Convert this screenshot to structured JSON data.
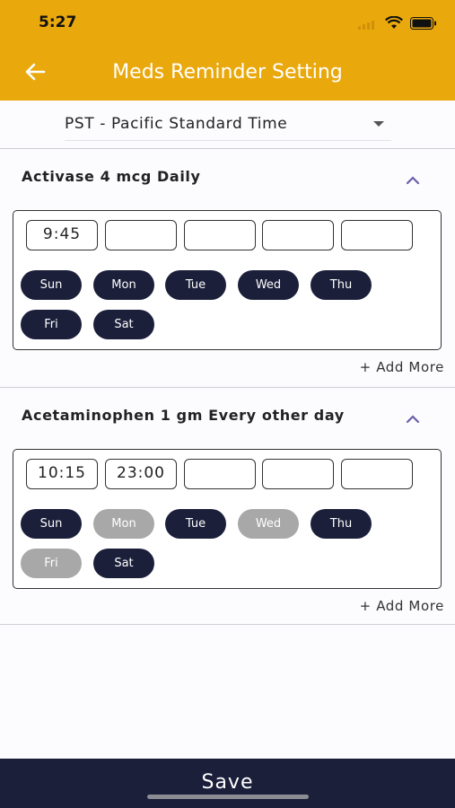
{
  "status": {
    "time": "5:27"
  },
  "header": {
    "title": "Meds Reminder Setting"
  },
  "timezone": {
    "value": "PST - Pacific Standard Time"
  },
  "meds": [
    {
      "title": "Activase 4 mcg  Daily",
      "times": [
        "9:45",
        "",
        "",
        "",
        ""
      ],
      "days": [
        {
          "label": "Sun",
          "active": true
        },
        {
          "label": "Mon",
          "active": true
        },
        {
          "label": "Tue",
          "active": true
        },
        {
          "label": "Wed",
          "active": true
        },
        {
          "label": "Thu",
          "active": true
        },
        {
          "label": "Fri",
          "active": true
        },
        {
          "label": "Sat",
          "active": true
        }
      ],
      "add_more": "+ Add More"
    },
    {
      "title": "Acetaminophen 1 gm  Every other day",
      "times": [
        "10:15",
        "23:00",
        "",
        "",
        ""
      ],
      "days": [
        {
          "label": "Sun",
          "active": true
        },
        {
          "label": "Mon",
          "active": false
        },
        {
          "label": "Tue",
          "active": true
        },
        {
          "label": "Wed",
          "active": false
        },
        {
          "label": "Thu",
          "active": true
        },
        {
          "label": "Fri",
          "active": false
        },
        {
          "label": "Sat",
          "active": true
        }
      ],
      "add_more": "+ Add More"
    }
  ],
  "footer": {
    "save_label": "Save"
  },
  "colors": {
    "header": "#e9a80c",
    "active_day": "#1b1f3a",
    "inactive_day": "#a8a8a8",
    "footer": "#1b1f3a",
    "chevron": "#6b5fa8"
  },
  "icons": {
    "back": "arrow-left-icon",
    "collapse": "chevron-up-icon",
    "dropdown": "caret-down-icon"
  }
}
